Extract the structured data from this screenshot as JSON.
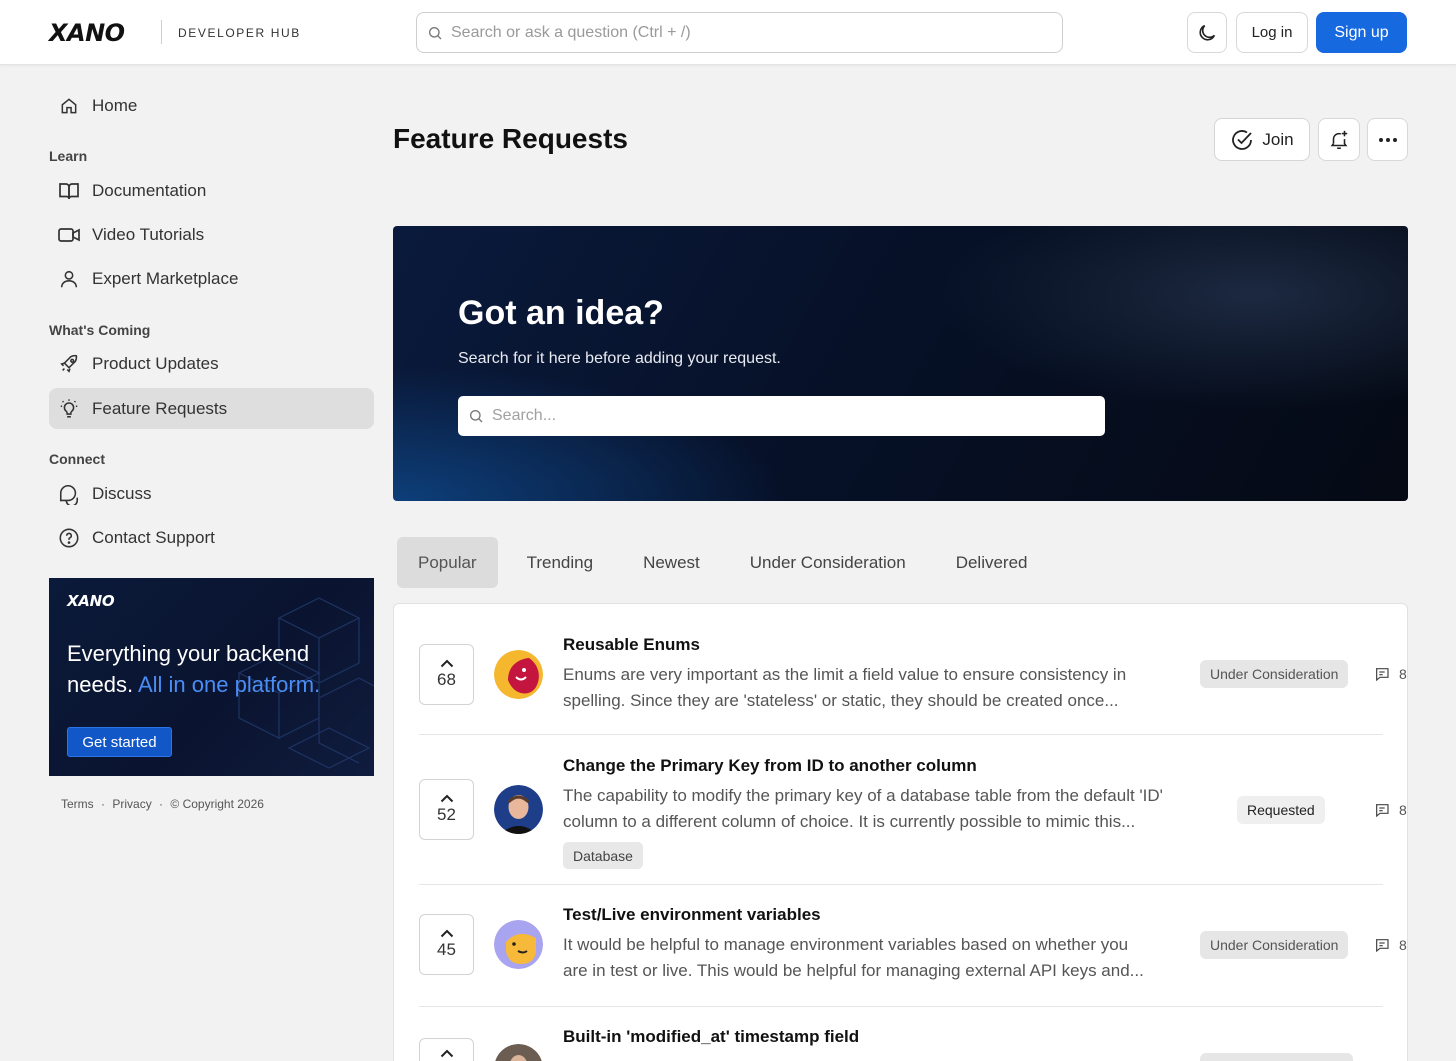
{
  "header": {
    "logo": "XANO",
    "hub_label": "DEVELOPER HUB",
    "search_placeholder": "Search or ask a question (Ctrl + /)",
    "login_label": "Log in",
    "signup_label": "Sign up",
    "theme_icon": "moon-icon"
  },
  "sidebar": {
    "home": "Home",
    "sections": {
      "learn": "Learn",
      "whats_coming": "What's Coming",
      "connect": "Connect"
    },
    "items": {
      "documentation": "Documentation",
      "video_tutorials": "Video Tutorials",
      "expert_marketplace": "Expert Marketplace",
      "product_updates": "Product Updates",
      "feature_requests": "Feature Requests",
      "discuss": "Discuss",
      "contact_support": "Contact Support"
    },
    "promo": {
      "logo": "XANO",
      "text_main": "Everything your backend needs.",
      "text_highlight": "All in one platform.",
      "button": "Get started"
    },
    "footer": {
      "terms": "Terms",
      "privacy": "Privacy",
      "copyright": "© Copyright 2026",
      "separator": "·"
    }
  },
  "main": {
    "title": "Feature Requests",
    "join_label": "Join",
    "hero": {
      "title": "Got an idea?",
      "subtitle": "Search for it here before adding your request.",
      "search_placeholder": "Search..."
    },
    "tabs": [
      "Popular",
      "Trending",
      "Newest",
      "Under Consideration",
      "Delivered"
    ],
    "active_tab": "Popular",
    "requests": [
      {
        "votes": "68",
        "title": "Reusable Enums",
        "desc_line1": "Enums are very important as the limit a field value to ensure consistency in",
        "desc_line2": "spelling. Since they are 'stateless' or static, they should be created once...",
        "status": "Under Consideration",
        "comments": "8"
      },
      {
        "votes": "52",
        "title": "Change the Primary Key from ID to another column",
        "desc_line1": "The capability to modify the primary key of a database table from the default 'ID'",
        "desc_line2": "column to a different column of choice. It is currently possible to mimic this...",
        "tag": "Database",
        "status": "Requested",
        "comments": "8"
      },
      {
        "votes": "45",
        "title": "Test/Live environment variables",
        "desc_line1": "It would be helpful to manage environment variables based on whether you",
        "desc_line2": "are in test or live. This would be helpful for managing external API keys and...",
        "status": "Under Consideration",
        "comments": "8"
      },
      {
        "title": "Built-in 'modified_at' timestamp field"
      }
    ]
  },
  "colors": {
    "primary": "#1769e0",
    "promo_highlight": "#4a8df5",
    "hero_bg": "#061026"
  }
}
